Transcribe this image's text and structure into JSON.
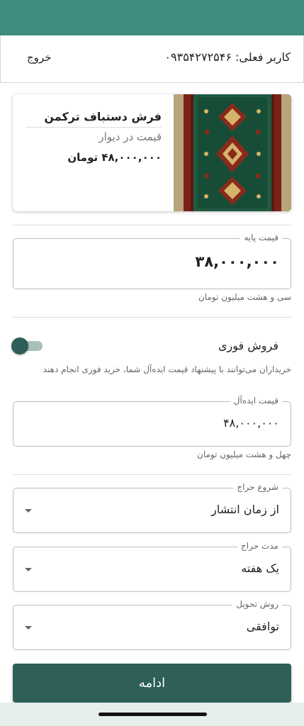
{
  "header": {
    "user_label": "کاربر فعلی: ۰۹۳۵۴۲۷۲۵۴۶",
    "logout_label": "خروج"
  },
  "product": {
    "title": "فرش دستباف ترکمن",
    "wall_price_label": "قیمت در دیوار",
    "wall_price": "۴۸,۰۰۰,۰۰۰ تومان"
  },
  "base_price": {
    "label": "قیمت پایه",
    "value": "۳۸,۰۰۰,۰۰۰",
    "helper": "سی و هشت میلیون تومان"
  },
  "instant_sale": {
    "title": "فروش فوری",
    "enabled": false,
    "description": "خریداران می‌توانند با پیشنهاد قیمت ایده‌آل شما، خرید فوری انجام دهند"
  },
  "ideal_price": {
    "label": "قیمت ایده‌آل",
    "value": "۴۸,۰۰۰,۰۰۰",
    "helper": "چهل و هشت میلیون تومان"
  },
  "auction_start": {
    "label": "شروع حراج",
    "value": "از زمان انتشار"
  },
  "auction_duration": {
    "label": "مدت حراج",
    "value": "یک هفته"
  },
  "delivery_method": {
    "label": "روش تحویل",
    "value": "توافقی"
  },
  "continue_label": "ادامه",
  "colors": {
    "brand": "#3f8d7e",
    "button": "#2e5f59"
  }
}
